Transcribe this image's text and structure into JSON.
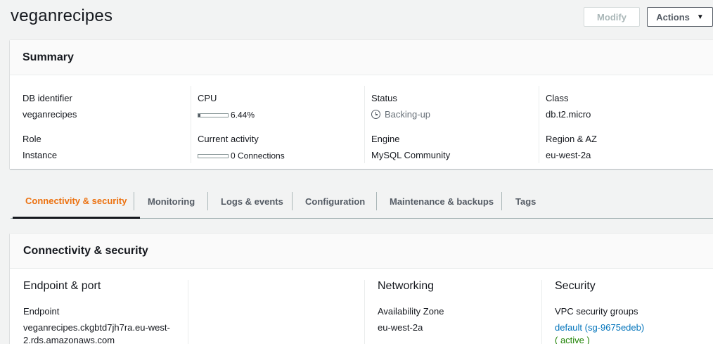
{
  "page": {
    "title": "veganrecipes"
  },
  "actions": {
    "modify_label": "Modify",
    "actions_label": "Actions",
    "actions_caret": "▼"
  },
  "summary": {
    "header": "Summary",
    "db_identifier": {
      "label": "DB identifier",
      "value": "veganrecipes"
    },
    "role": {
      "label": "Role",
      "value": "Instance"
    },
    "cpu": {
      "label": "CPU",
      "value": "6.44%",
      "fraction": 0.0644
    },
    "current_activity": {
      "label": "Current activity",
      "value": "0 Connections",
      "fraction": 0
    },
    "status": {
      "label": "Status",
      "value": "Backing-up",
      "icon": "clock-icon"
    },
    "engine": {
      "label": "Engine",
      "value": "MySQL Community"
    },
    "class": {
      "label": "Class",
      "value": "db.t2.micro"
    },
    "region": {
      "label": "Region & AZ",
      "value": "eu-west-2a"
    }
  },
  "tabs": [
    {
      "label": "Connectivity & security",
      "active": true
    },
    {
      "label": "Monitoring",
      "active": false
    },
    {
      "label": "Logs & events",
      "active": false
    },
    {
      "label": "Configuration",
      "active": false
    },
    {
      "label": "Maintenance & backups",
      "active": false
    },
    {
      "label": "Tags",
      "active": false
    }
  ],
  "connectivity": {
    "header": "Connectivity & security",
    "endpoint_port": {
      "heading": "Endpoint & port",
      "endpoint_label": "Endpoint",
      "endpoint_line1": "veganrecipes.ckgbtd7jh7ra.eu-west-",
      "endpoint_line2": "2.rds.amazonaws.com"
    },
    "networking": {
      "heading": "Networking",
      "az_label": "Availability Zone",
      "az_value": "eu-west-2a"
    },
    "security": {
      "heading": "Security",
      "vpc_label": "VPC security groups",
      "vpc_link": "default (sg-9675edeb)",
      "vpc_status": "( active )"
    }
  },
  "colors": {
    "accent": "#ec7211",
    "link": "#0073bb",
    "active": "#1d8102"
  }
}
